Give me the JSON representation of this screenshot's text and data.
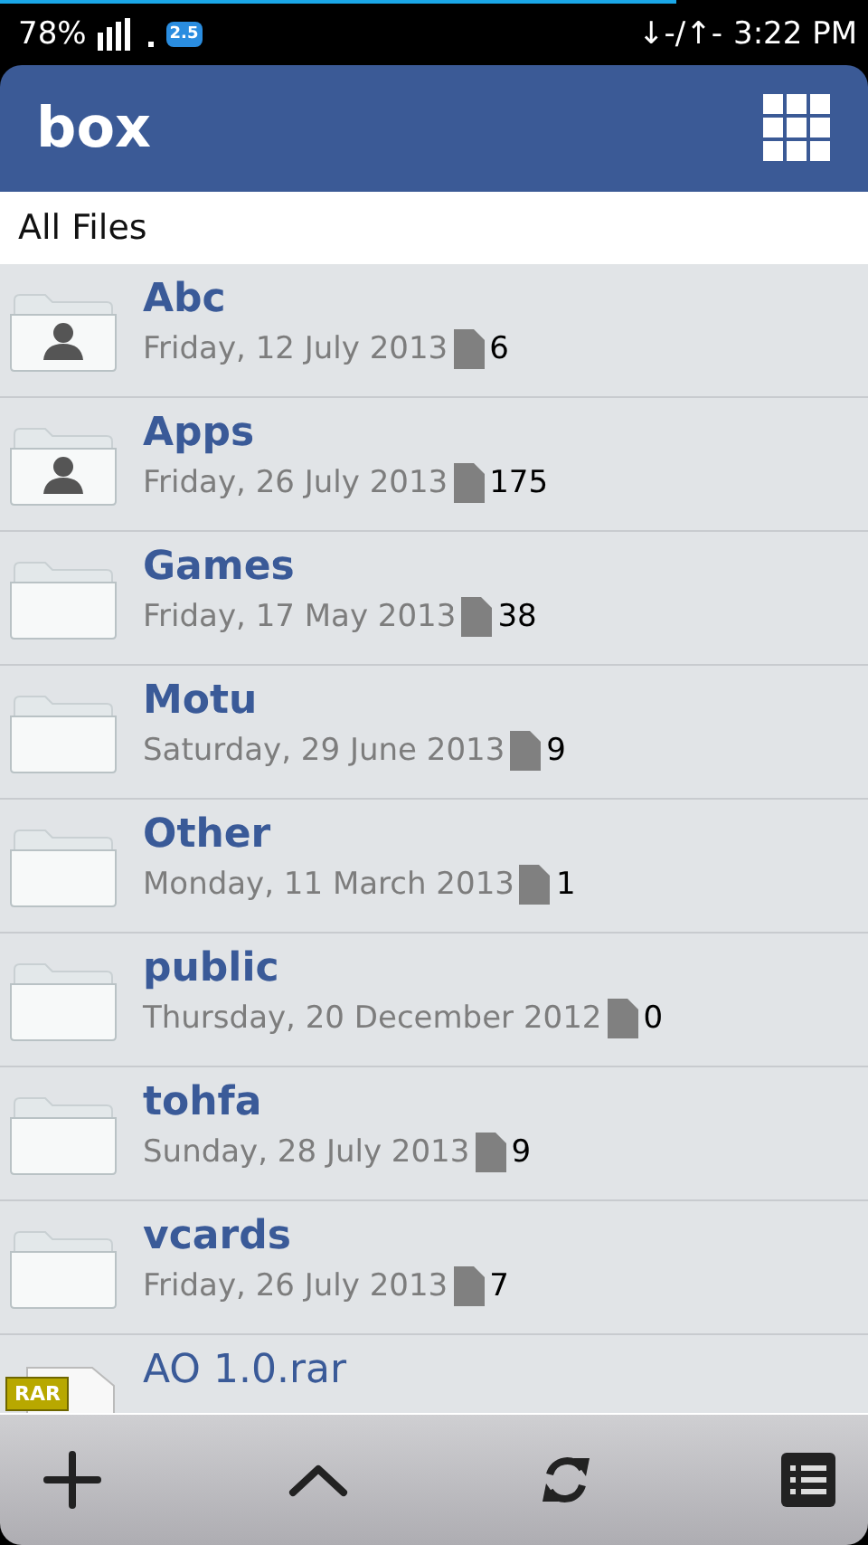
{
  "status_bar": {
    "battery": "78%",
    "badge": "2.5",
    "traffic": "↓-/↑-",
    "time": "3:22 PM"
  },
  "header": {
    "title": "box"
  },
  "path": "All Files",
  "items": [
    {
      "kind": "shared_folder",
      "name": "Abc",
      "date": "Friday, 12 July 2013",
      "count": "6"
    },
    {
      "kind": "shared_folder",
      "name": "Apps",
      "date": "Friday, 26 July 2013",
      "count": "175"
    },
    {
      "kind": "folder",
      "name": "Games",
      "date": "Friday, 17 May 2013",
      "count": "38"
    },
    {
      "kind": "folder",
      "name": "Motu",
      "date": "Saturday, 29 June 2013",
      "count": "9"
    },
    {
      "kind": "folder",
      "name": "Other",
      "date": "Monday, 11 March 2013",
      "count": "1"
    },
    {
      "kind": "folder",
      "name": "public",
      "date": "Thursday, 20 December 2012",
      "count": "0"
    },
    {
      "kind": "folder",
      "name": "tohfa",
      "date": "Sunday, 28 July 2013",
      "count": "9"
    },
    {
      "kind": "folder",
      "name": "vcards",
      "date": "Friday, 26 July 2013",
      "count": "7"
    },
    {
      "kind": "file",
      "name": "AO 1.0.rar",
      "badge": "RAR"
    }
  ],
  "toolbar": [
    {
      "kind": "add"
    },
    {
      "kind": "up"
    },
    {
      "kind": "refresh"
    },
    {
      "kind": "list"
    }
  ]
}
